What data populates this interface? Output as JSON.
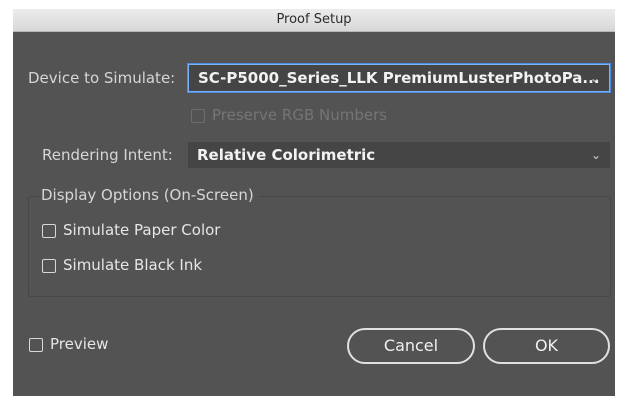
{
  "window": {
    "title": "Proof Setup"
  },
  "device": {
    "label": "Device to Simulate:",
    "value": "SC-P5000_Series_LLK PremiumLusterPhotoPa...",
    "preserve_rgb_label": "Preserve RGB Numbers",
    "preserve_rgb_checked": false
  },
  "rendering": {
    "label": "Rendering Intent:",
    "value": "Relative Colorimetric"
  },
  "display_options": {
    "title": "Display Options (On-Screen)",
    "simulate_paper_label": "Simulate Paper Color",
    "simulate_paper_checked": false,
    "simulate_black_label": "Simulate Black Ink",
    "simulate_black_checked": false
  },
  "preview": {
    "label": "Preview",
    "checked": false
  },
  "buttons": {
    "cancel": "Cancel",
    "ok": "OK"
  },
  "icons": {
    "dropdown": "chevron-down-icon"
  },
  "colors": {
    "panel": "#535353",
    "focus": "#4b8de0",
    "titlebar": "#e3e3e3"
  }
}
